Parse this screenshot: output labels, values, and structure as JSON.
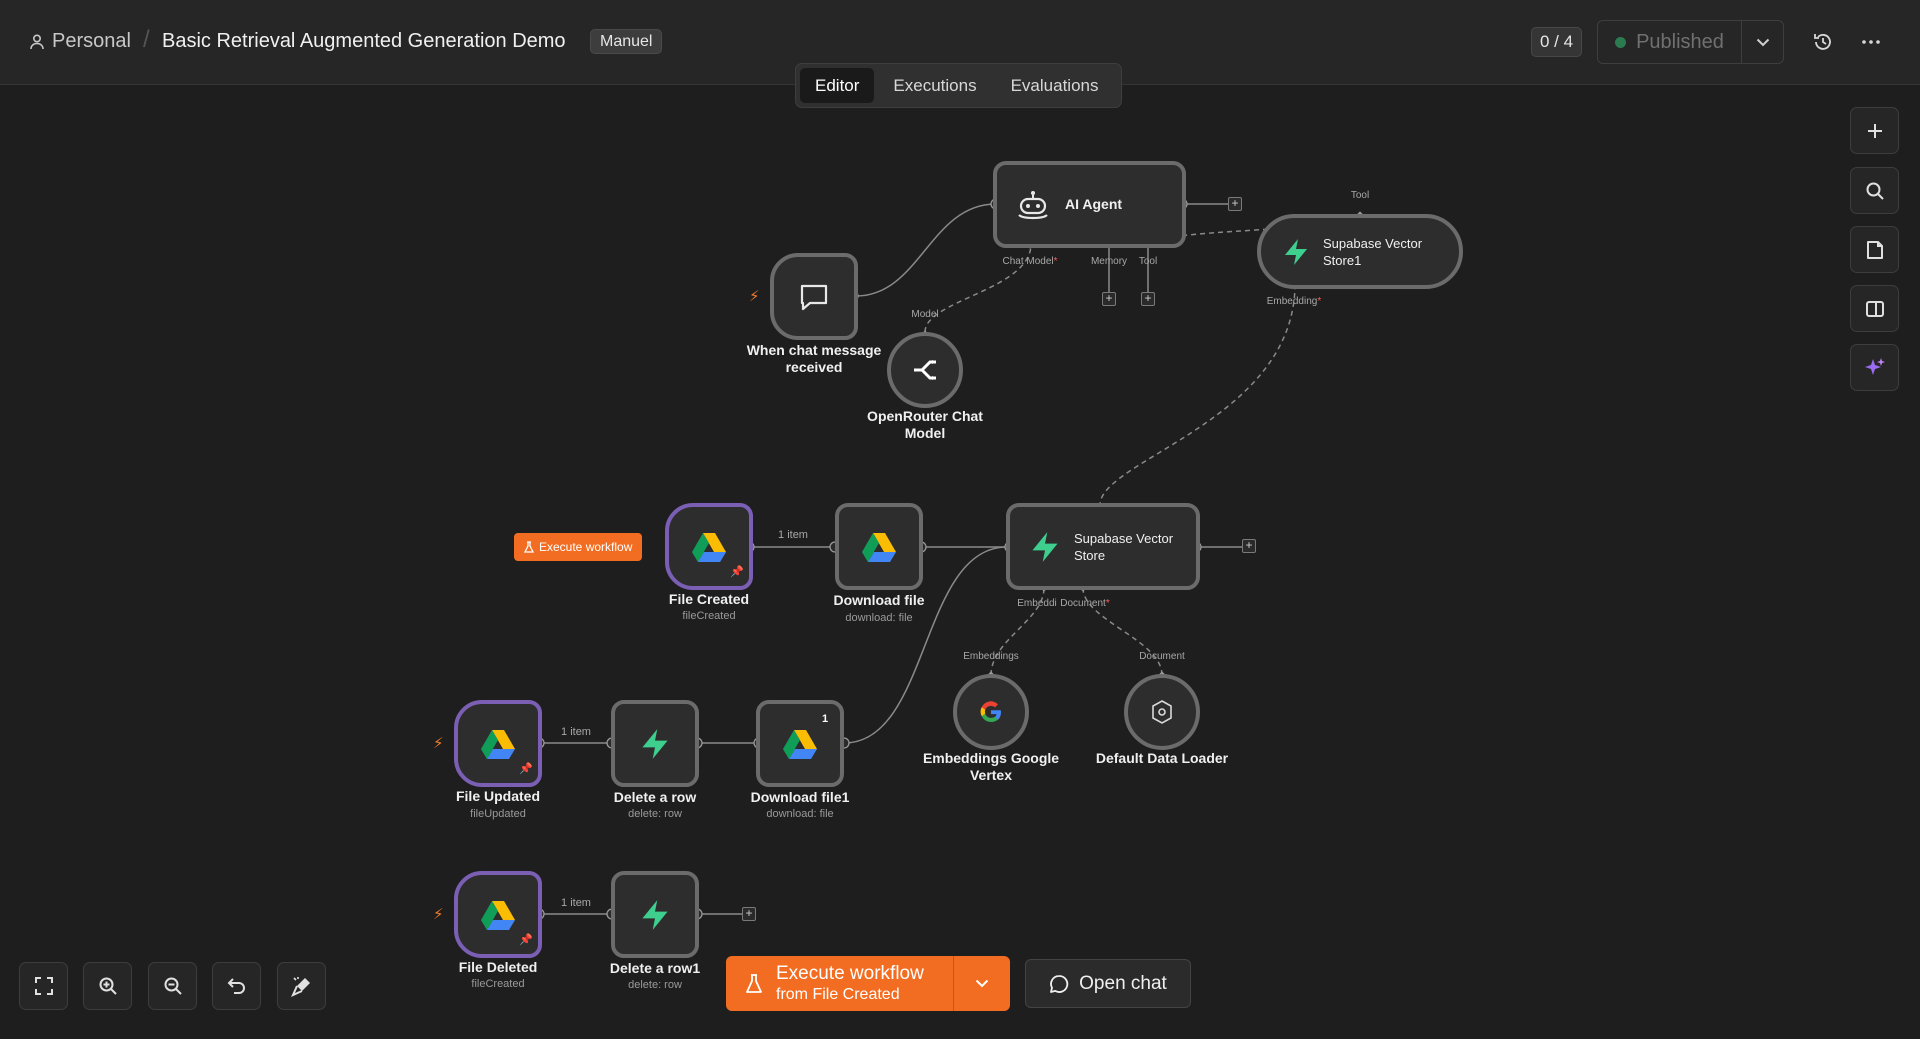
{
  "header": {
    "personal_label": "Personal",
    "separator": "/",
    "workflow_title": "Basic Retrieval Augmented Generation Demo",
    "tag": "Manuel",
    "counter": "0 / 4",
    "publish_label": "Published"
  },
  "tabs": [
    {
      "label": "Editor",
      "active": true
    },
    {
      "label": "Executions",
      "active": false
    },
    {
      "label": "Evaluations",
      "active": false
    }
  ],
  "icons": {
    "right_toolbar": [
      "plus-icon",
      "search-icon",
      "sticky-note-icon",
      "panel-icon",
      "ai-sparkle-icon"
    ],
    "bottom_toolbar": [
      "fit-view-icon",
      "zoom-in-icon",
      "zoom-out-icon",
      "undo-icon",
      "tidy-up-icon"
    ],
    "header": [
      "user-icon",
      "history-icon",
      "more-icon"
    ]
  },
  "colors": {
    "accent": "#f26d21",
    "node_border": "#6b6b6b",
    "selected_border": "#7a5fb5",
    "supabase": "#3ecf8e",
    "published_dot": "#2c7a50"
  },
  "bottom": {
    "execute_line1": "Execute workflow",
    "execute_line2": "from File Created",
    "open_chat": "Open chat"
  },
  "canvas": {
    "execute_badge": "Execute workflow",
    "nodes": {
      "chat_trigger": {
        "label_line1": "When chat message",
        "label_line2": "received"
      },
      "ai_agent": {
        "label": "AI Agent",
        "handle_chat_model": "Chat Model",
        "handle_memory": "Memory",
        "handle_tool": "Tool"
      },
      "openrouter": {
        "label_line1": "OpenRouter Chat",
        "label_line2": "Model",
        "handle": "Model"
      },
      "supabase_store1": {
        "label_line1": "Supabase Vector",
        "label_line2": "Store1",
        "handle_tool": "Tool",
        "handle_embedding": "Embedding"
      },
      "file_created": {
        "label": "File Created",
        "sub": "fileCreated"
      },
      "download_file": {
        "label": "Download file",
        "sub": "download: file"
      },
      "supabase_store": {
        "label_line1": "Supabase Vector",
        "label_line2": "Store",
        "handle_embedding": "Embeddi",
        "handle_document": "Document"
      },
      "embeddings": {
        "label_line1": "Embeddings Google",
        "label_line2": "Vertex",
        "handle": "Embeddings"
      },
      "data_loader": {
        "label": "Default Data Loader",
        "handle": "Document"
      },
      "file_updated": {
        "label": "File Updated",
        "sub": "fileUpdated"
      },
      "delete_row": {
        "label": "Delete a row",
        "sub": "delete: row"
      },
      "download_file1": {
        "label": "Download file1",
        "sub": "download: file",
        "badge": "1"
      },
      "file_deleted": {
        "label": "File Deleted",
        "sub": "fileCreated"
      },
      "delete_row1": {
        "label": "Delete a row1",
        "sub": "delete: row"
      }
    },
    "edge_labels": {
      "created_to_download": "1 item",
      "updated_to_delete": "1 item",
      "deleted_to_delete": "1 item"
    }
  }
}
